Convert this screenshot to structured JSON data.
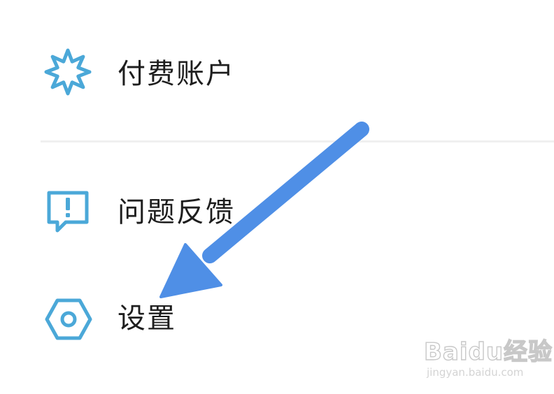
{
  "colors": {
    "icon_accent": "#4ba8d8",
    "arrow": "#4f8fe6",
    "text": "#1e1e1e",
    "divider": "#f0f0f0"
  },
  "menu": {
    "items": [
      {
        "label": "付费账户",
        "icon": "starburst-icon"
      },
      {
        "label": "问题反馈",
        "icon": "feedback-bubble-icon"
      },
      {
        "label": "设置",
        "icon": "hexagon-gear-icon"
      }
    ]
  },
  "annotation": {
    "icon": "arrow-pointer-icon"
  },
  "watermark": {
    "brand": "Baidu经验",
    "url": "jingyan.baidu.com"
  }
}
